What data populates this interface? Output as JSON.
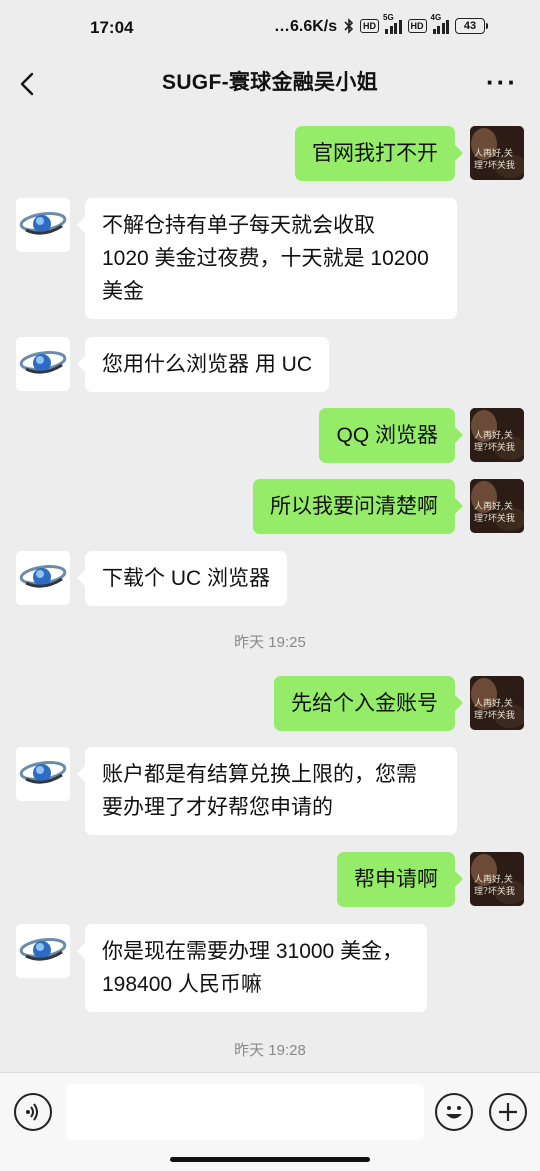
{
  "status_bar": {
    "time": "17:04",
    "network_speed": "…6.6K/s",
    "hd_label": "HD",
    "sim1_label": "5G",
    "sim2_label": "4G",
    "battery": "43"
  },
  "header": {
    "title": "SUGF-寰球金融吴小姐",
    "back_icon": "chevron-left-icon",
    "more_icon": "more-dots-icon"
  },
  "messages": [
    {
      "side": "right",
      "text": "官网我打不开"
    },
    {
      "side": "left",
      "lines": [
        "不解仓持有单子每天就会收取",
        "1020 美金过夜费，十天就是 10200",
        "美金"
      ]
    },
    {
      "side": "left",
      "text": "您用什么浏览器 用 UC"
    },
    {
      "side": "right",
      "text": "QQ 浏览器"
    },
    {
      "side": "right",
      "text": "所以我要问清楚啊"
    },
    {
      "side": "left",
      "text": "下载个 UC 浏览器"
    },
    {
      "timestamp": "昨天 19:25"
    },
    {
      "side": "right",
      "text": "先给个入金账号"
    },
    {
      "side": "left",
      "lines": [
        "账户都是有结算兑换上限的，您需",
        "要办理了才好帮您申请的"
      ]
    },
    {
      "side": "right",
      "text": "帮申请啊"
    },
    {
      "side": "left",
      "lines": [
        "你是现在需要办理 31000 美金，",
        "198400 人民币嘛"
      ]
    },
    {
      "timestamp": "昨天 19:28"
    }
  ],
  "avatars": {
    "contact_avatar_icon": "globe-logo-icon",
    "self_avatar_text": [
      "人再好,关我什么",
      "理?坏关我人什"
    ]
  },
  "input_bar": {
    "voice_icon": "voice-icon",
    "emoji_icon": "emoji-icon",
    "plus_icon": "plus-icon",
    "input_value": ""
  },
  "colors": {
    "background": "#EDEDED",
    "sent_bubble": "#95EC69",
    "received_bubble": "#FFFFFF"
  }
}
